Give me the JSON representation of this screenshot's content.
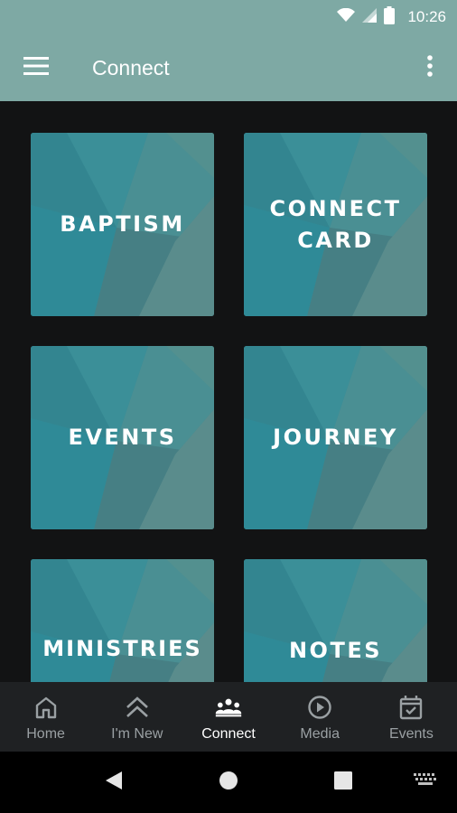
{
  "status_bar": {
    "time": "10:26"
  },
  "app_bar": {
    "title": "Connect",
    "menu_icon": "hamburger-menu-icon",
    "overflow_icon": "more-vert-icon"
  },
  "tiles": [
    {
      "label": "BAPTISM"
    },
    {
      "label": "CONNECT\nCARD"
    },
    {
      "label": "EVENTS"
    },
    {
      "label": "JOURNEY"
    },
    {
      "label": "MINISTRIES"
    },
    {
      "label": "NOTES"
    }
  ],
  "bottom_nav": {
    "items": [
      {
        "label": "Home",
        "icon": "home-icon"
      },
      {
        "label": "I'm New",
        "icon": "double-chevron-up-icon"
      },
      {
        "label": "Connect",
        "icon": "people-group-icon",
        "active": true
      },
      {
        "label": "Media",
        "icon": "play-circle-icon"
      },
      {
        "label": "Events",
        "icon": "calendar-check-icon"
      }
    ]
  },
  "colors": {
    "app_bar": "#7ea9a4",
    "tile_base": "#3a8d96",
    "background": "#121314",
    "nav_background": "#1f2123",
    "nav_inactive": "#9aa0a3",
    "nav_active": "#ffffff"
  }
}
